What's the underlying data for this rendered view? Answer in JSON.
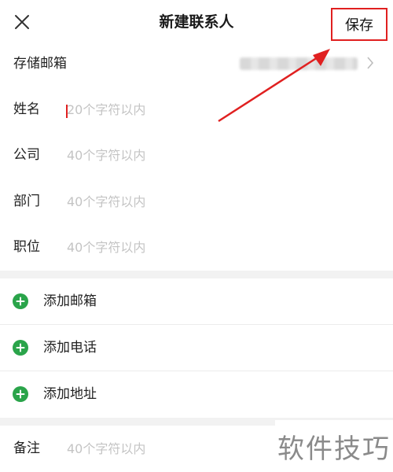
{
  "header": {
    "title": "新建联系人",
    "save_label": "保存",
    "close_icon": "close-icon"
  },
  "storage": {
    "label": "存储邮箱",
    "value_icon": "chevron-right-icon"
  },
  "fields": [
    {
      "label": "姓名",
      "placeholder": "20个字符以内"
    },
    {
      "label": "公司",
      "placeholder": "40个字符以内"
    },
    {
      "label": "部门",
      "placeholder": "40个字符以内"
    },
    {
      "label": "职位",
      "placeholder": "40个字符以内"
    }
  ],
  "add_actions": [
    {
      "label": "添加邮箱",
      "icon": "plus-circle-icon"
    },
    {
      "label": "添加电话",
      "icon": "plus-circle-icon"
    },
    {
      "label": "添加地址",
      "icon": "plus-circle-icon"
    }
  ],
  "note": {
    "label": "备注",
    "placeholder": "40个字符以内"
  },
  "watermark": "软件技巧",
  "colors": {
    "accent_green": "#2aa44a",
    "highlight_red": "#e02020",
    "placeholder_gray": "#c4c4c4",
    "divider_gray": "#f2f2f2"
  }
}
